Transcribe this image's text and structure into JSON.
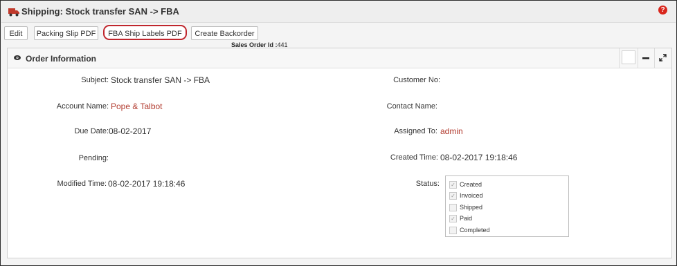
{
  "header": {
    "title": "Shipping: Stock transfer SAN -> FBA",
    "help_glyph": "?"
  },
  "toolbar": {
    "edit_label": "Edit",
    "packing_slip_label": "Packing Slip PDF",
    "fba_labels_label": "FBA Ship Labels PDF",
    "create_backorder_label": "Create Backorder"
  },
  "sales_order": {
    "label": "Sales Order Id :",
    "value": "441"
  },
  "panel": {
    "title": "Order Information"
  },
  "fields": {
    "subject": {
      "label": "Subject:",
      "value": "Stock transfer SAN -> FBA"
    },
    "account_name": {
      "label": "Account Name:",
      "value": "Pope & Talbot"
    },
    "due_date": {
      "label": "Due Date:",
      "value": "08-02-2017"
    },
    "pending": {
      "label": "Pending:",
      "value": ""
    },
    "modified_time": {
      "label": "Modified Time:",
      "value": "08-02-2017 19:18:46"
    },
    "customer_no": {
      "label": "Customer No:",
      "value": ""
    },
    "contact_name": {
      "label": "Contact Name:",
      "value": ""
    },
    "assigned_to": {
      "label": "Assigned To:",
      "value": "admin"
    },
    "created_time": {
      "label": "Created Time:",
      "value": "08-02-2017 19:18:46"
    },
    "status": {
      "label": "Status:"
    }
  },
  "status_options": [
    {
      "label": "Created",
      "checked": true
    },
    {
      "label": "Invoiced",
      "checked": true
    },
    {
      "label": "Shipped",
      "checked": false
    },
    {
      "label": "Paid",
      "checked": true
    },
    {
      "label": "Completed",
      "checked": false
    }
  ],
  "colors": {
    "link": "#b23b2f",
    "highlight": "#c0262d",
    "help": "#d9261c"
  }
}
